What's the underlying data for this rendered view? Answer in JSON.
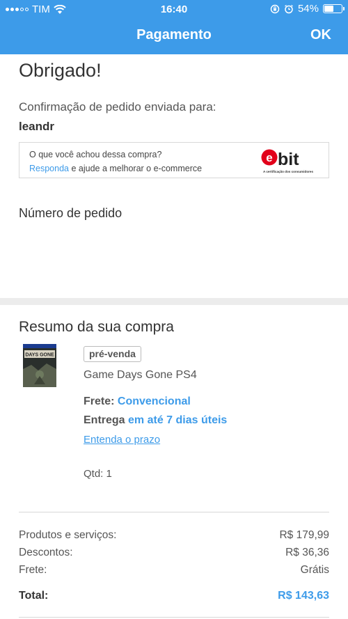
{
  "status_bar": {
    "carrier": "TIM",
    "time": "16:40",
    "battery_percent": 54,
    "battery_text": "54%",
    "icons": [
      "signal-icon",
      "wifi-icon",
      "orientation-lock-icon",
      "alarm-icon",
      "battery-icon"
    ]
  },
  "nav": {
    "title": "Pagamento",
    "ok_label": "OK"
  },
  "thanks": "Obrigado!",
  "confirmation": {
    "label": "Confirmação de pedido enviada para:",
    "email": "leandr"
  },
  "ebit": {
    "question": "O que você achou dessa compra?",
    "link": "Responda",
    "rest": " e ajude a melhorar o e-commerce",
    "logo_text": "ebit",
    "logo_tagline": "A certificação dos consumidores",
    "accent": "#e2001a"
  },
  "order_number_label": "Número de pedido",
  "summary": {
    "title": "Resumo da sua compra",
    "badge": "pré-venda",
    "product": "Game Days Gone PS4",
    "thumb_text": "DAYS GONE",
    "frete_label": "Frete:",
    "frete_value": "Convencional",
    "entrega_label": "Entrega",
    "entrega_value": "em até 7 dias úteis",
    "prazo_link": "Entenda o prazo",
    "qtd": "Qtd: 1"
  },
  "totals": {
    "rows": [
      {
        "label": "Produtos e serviços:",
        "value": "R$ 179,99"
      },
      {
        "label": "Descontos:",
        "value": "R$ 36,36"
      },
      {
        "label": "Frete:",
        "value": "Grátis"
      }
    ],
    "total_label": "Total:",
    "total_value": "R$ 143,63"
  },
  "colors": {
    "primary": "#3d9be9",
    "ebit_red": "#e2001a"
  }
}
